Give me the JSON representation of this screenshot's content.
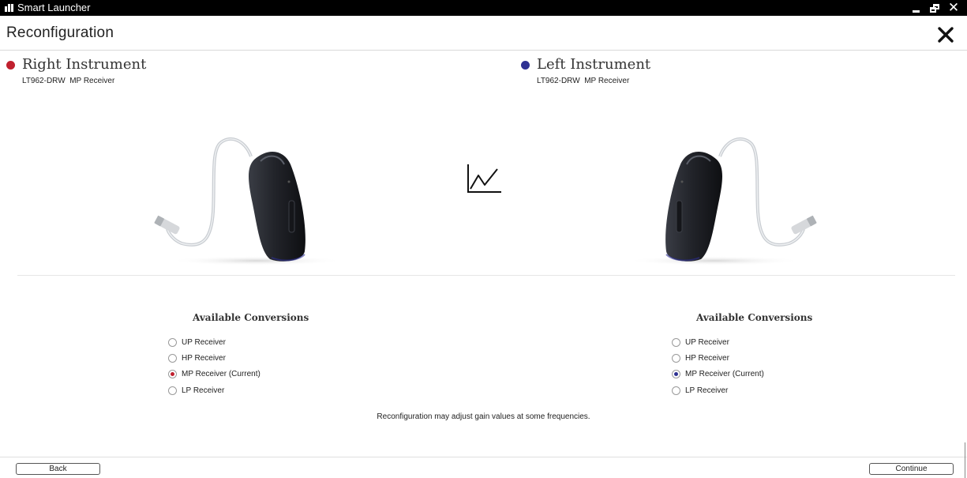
{
  "window": {
    "title": "Smart Launcher"
  },
  "header": {
    "title": "Reconfiguration"
  },
  "colors": {
    "right": "#c0202e",
    "left": "#2e3192"
  },
  "right_instrument": {
    "title": "Right Instrument",
    "model": "LT962-DRW",
    "receiver": "MP Receiver",
    "conversions_heading": "Available Conversions",
    "options": [
      "UP Receiver",
      "HP Receiver",
      "MP Receiver (Current)",
      "LP Receiver"
    ],
    "selected": "MP Receiver (Current)"
  },
  "left_instrument": {
    "title": "Left Instrument",
    "model": "LT962-DRW",
    "receiver": "MP Receiver",
    "conversions_heading": "Available Conversions",
    "options": [
      "UP Receiver",
      "HP Receiver",
      "MP Receiver (Current)",
      "LP Receiver"
    ],
    "selected": "MP Receiver (Current)"
  },
  "note": "Reconfiguration may adjust gain values at some frequencies.",
  "footer": {
    "back_label": "Back",
    "continue_label": "Continue"
  },
  "icons": {
    "app": "signal-bars-icon",
    "close": "close-icon",
    "center": "line-chart-icon",
    "device": "hearing-aid-image"
  }
}
